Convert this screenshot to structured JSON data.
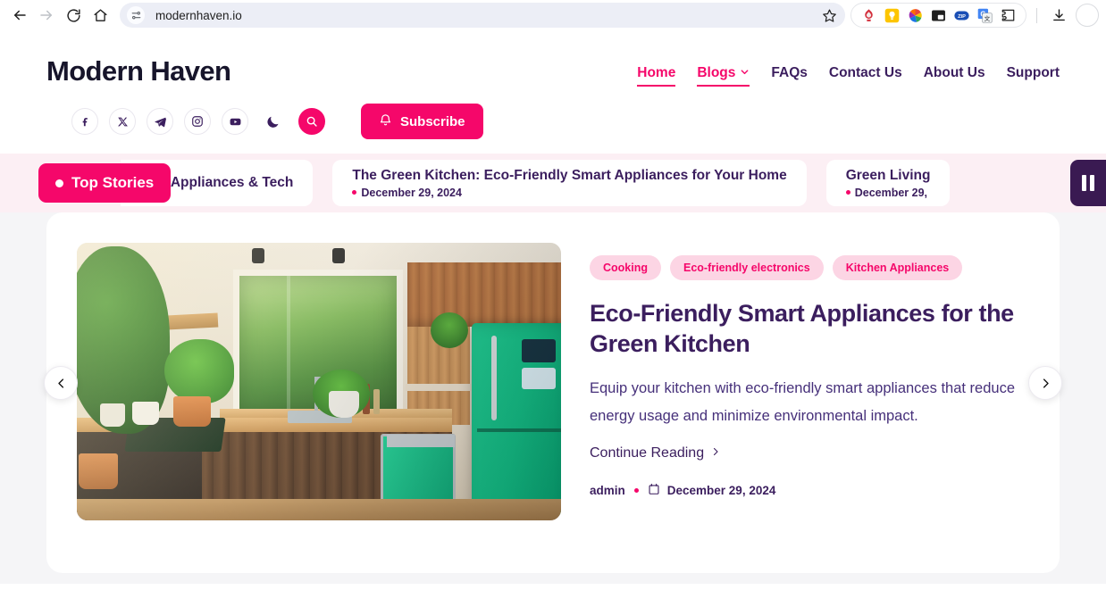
{
  "browser": {
    "url": "modernhaven.io",
    "back_label": "Back",
    "forward_label": "Forward",
    "reload_label": "Reload",
    "home_label": "Home",
    "site_info_label": "View site information",
    "bookmark_label": "Bookmark this tab",
    "download_label": "Downloads",
    "profile_label": "Profile",
    "extensions": [
      {
        "name": "red-stamp-extension-icon"
      },
      {
        "name": "lightbulb-extension-icon"
      },
      {
        "name": "color-wheel-extension-icon"
      },
      {
        "name": "picture-in-picture-extension-icon"
      },
      {
        "name": "zip-extension-icon"
      },
      {
        "name": "google-translate-extension-icon"
      },
      {
        "name": "puzzle-extensions-icon"
      }
    ]
  },
  "site": {
    "brand": "Modern Haven",
    "nav": [
      {
        "label": "Home",
        "active": true,
        "has_chevron": false
      },
      {
        "label": "Blogs",
        "active": true,
        "has_chevron": true
      },
      {
        "label": "FAQs",
        "active": false,
        "has_chevron": false
      },
      {
        "label": "Contact Us",
        "active": false,
        "has_chevron": false
      },
      {
        "label": "About Us",
        "active": false,
        "has_chevron": false
      },
      {
        "label": "Support",
        "active": false,
        "has_chevron": false
      }
    ],
    "social": [
      {
        "name": "facebook-icon"
      },
      {
        "name": "x-twitter-icon"
      },
      {
        "name": "telegram-icon"
      },
      {
        "name": "instagram-icon"
      },
      {
        "name": "youtube-icon"
      },
      {
        "name": "dark-mode-moon-icon"
      },
      {
        "name": "search-icon"
      }
    ],
    "subscribe_label": "Subscribe",
    "colors": {
      "accent_pink": "#f5076a",
      "tag_bg": "#fcd5e4",
      "deep_purple": "#3b1e5e",
      "pause_purple": "#3a1a52",
      "ticker_bg": "#fceff4",
      "page_bg": "#f5f5f7"
    }
  },
  "ticker": {
    "badge_label": "Top Stories",
    "pause_label": "Pause",
    "items": [
      {
        "title": "Eco-Friendly Smart Appliances & Tech",
        "date": ""
      },
      {
        "title": "The Green Kitchen: Eco-Friendly Smart Appliances for Your Home",
        "date": "December 29, 2024"
      },
      {
        "title": "Green Living",
        "date": "December 29,"
      }
    ]
  },
  "hero": {
    "tags": [
      "Cooking",
      "Eco-friendly electronics",
      "Kitchen Appliances"
    ],
    "title": "Eco-Friendly Smart Appliances for the Green Kitchen",
    "description": "Equip your kitchen with eco-friendly smart appliances that reduce energy usage and minimize environmental impact.",
    "continue_label": "Continue Reading",
    "author": "admin",
    "date": "December 29, 2024",
    "image_alt": "modern kitchen with green refrigerator wooden cabinets and houseplants",
    "prev_label": "Previous slide",
    "next_label": "Next slide"
  }
}
